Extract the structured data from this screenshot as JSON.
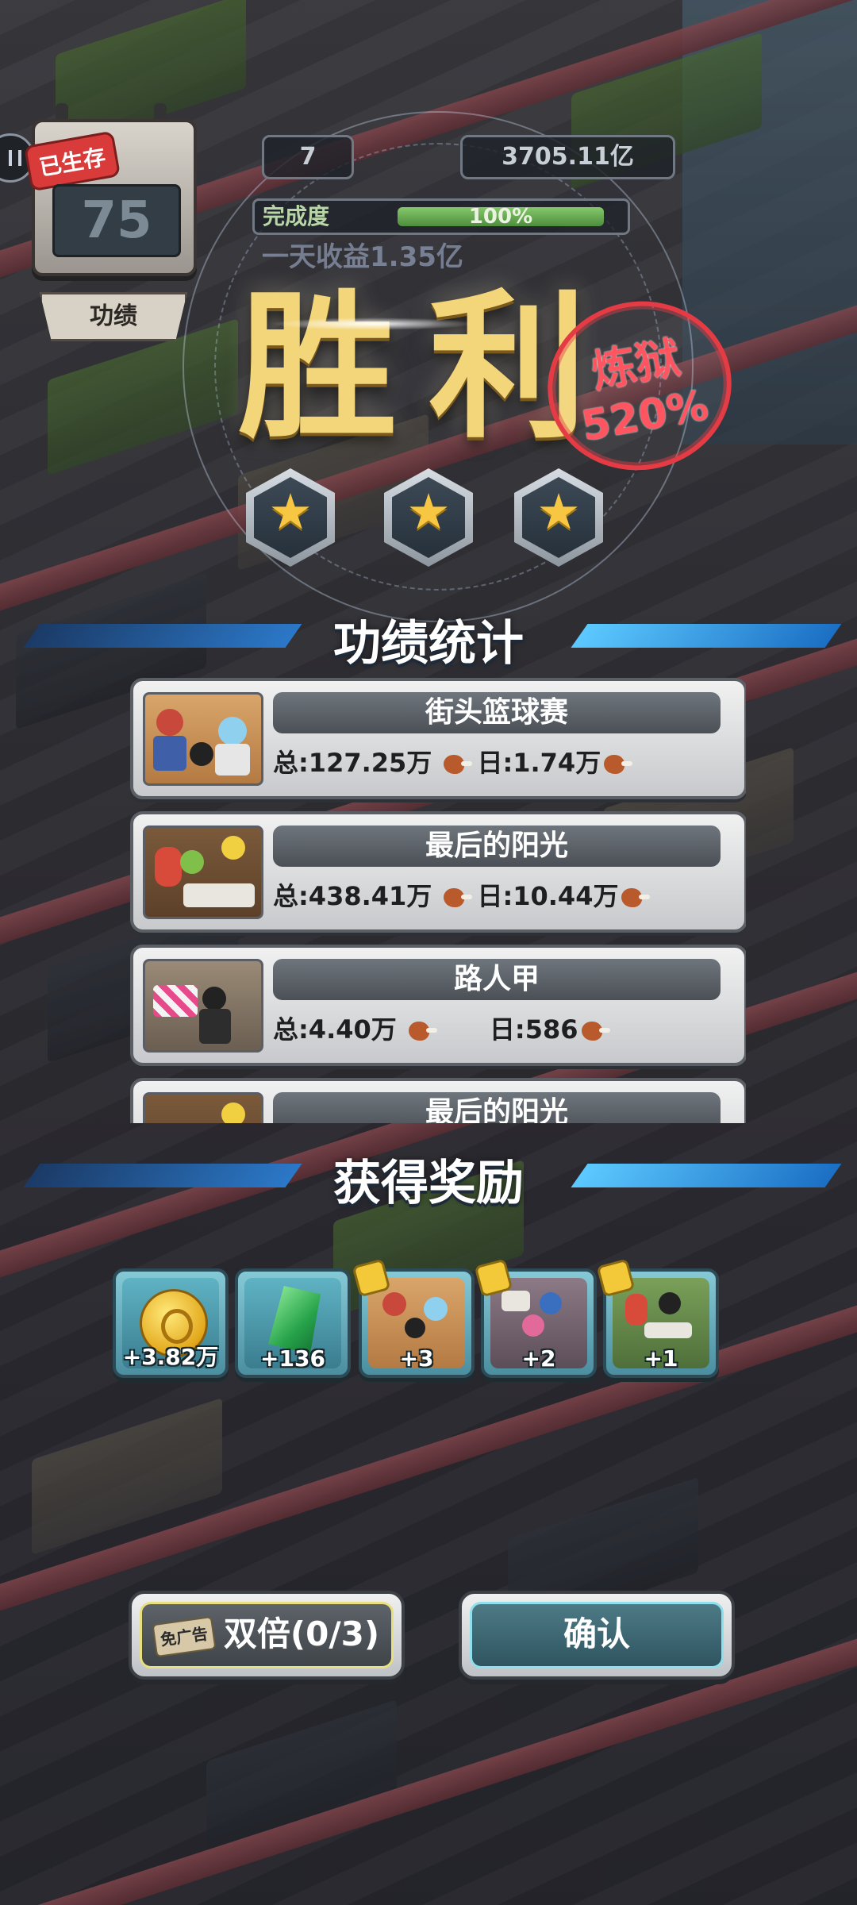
{
  "hud": {
    "survived_label": "已生存",
    "survived_days": "75",
    "merit_tab": "功绩",
    "level": "7",
    "total_amount": "3705.11亿",
    "progress_label": "完成度",
    "progress_text": "100%",
    "progress_fraction": 1.0,
    "ghost_text": "一天收益1.35亿"
  },
  "victory": {
    "title": "胜利",
    "stamp_line1": "炼狱",
    "stamp_line2": "520%",
    "stars": [
      "★",
      "★",
      "★"
    ]
  },
  "merit_section": {
    "title": "功绩统计",
    "items": [
      {
        "name": "街头篮球赛",
        "stats": "总:127.25万 ",
        "stats2": "日:1.74万",
        "thumb": "bball"
      },
      {
        "name": "最后的阳光",
        "stats": "总:438.41万 ",
        "stats2": "日:10.44万",
        "thumb": "sun"
      },
      {
        "name": "路人甲",
        "stats": "总:4.40万 ",
        "stats2": "日:586",
        "thumb": "road"
      },
      {
        "name": "最后的阳光",
        "stats": "",
        "stats2": "",
        "thumb": "sun"
      }
    ]
  },
  "reward_section": {
    "title": "获得奖励",
    "rewards": [
      {
        "amount": "+3.82万",
        "icon": "coin-icon"
      },
      {
        "amount": "+136",
        "icon": "gem-icon"
      },
      {
        "amount": "+3",
        "icon": "puzzle-card-icon"
      },
      {
        "amount": "+2",
        "icon": "puzzle-card-icon"
      },
      {
        "amount": "+1",
        "icon": "puzzle-card-icon"
      }
    ]
  },
  "buttons": {
    "ad_badge": "免广告",
    "double_label": "双倍(0/3)",
    "confirm_label": "确认"
  },
  "colors": {
    "victory_gold": "#f3d57a",
    "stamp_red": "#e53b45",
    "section_blue": "#5cc9ff"
  }
}
